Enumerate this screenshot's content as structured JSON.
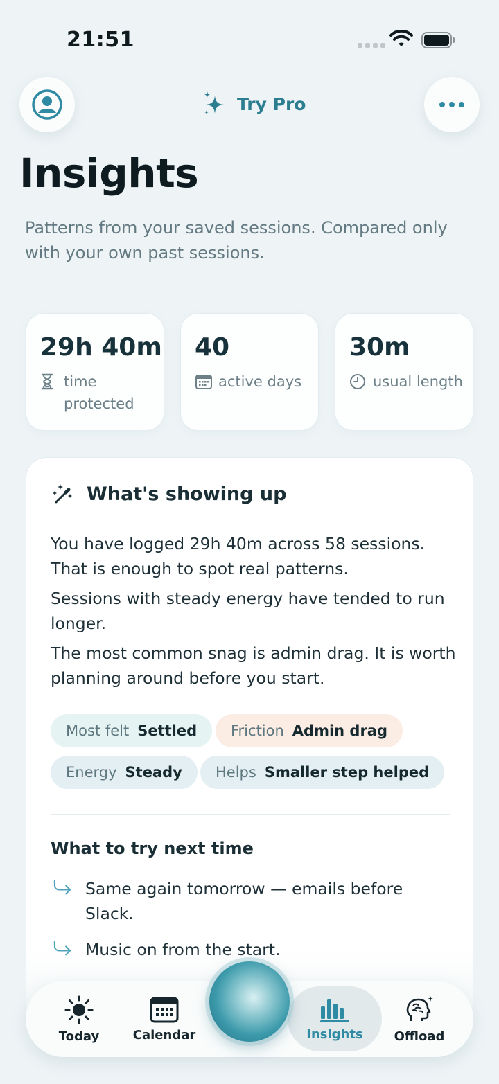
{
  "status": {
    "time": "21:51"
  },
  "header": {
    "try_pro_label": "Try Pro"
  },
  "page": {
    "title": "Insights",
    "subtitle": "Patterns from your saved sessions. Compared only with your own past sessions."
  },
  "stats": [
    {
      "value": "29h 40m",
      "label": "time protected",
      "icon": "hourglass-icon"
    },
    {
      "value": "40",
      "label": "active days",
      "icon": "calendar-icon"
    },
    {
      "value": "30m",
      "label": "usual length",
      "icon": "clock-icon"
    }
  ],
  "insight_card": {
    "title": "What's showing up",
    "lines": [
      "You have logged 29h 40m across 58 sessions. That is enough to spot real patterns.",
      "Sessions with steady energy have tended to run longer.",
      "The most common snag is admin drag. It is worth planning around before you start."
    ],
    "chips": [
      {
        "key": "Most felt",
        "value": "Settled"
      },
      {
        "key": "Friction",
        "value": "Admin drag"
      },
      {
        "key": "Energy",
        "value": "Steady"
      },
      {
        "key": "Helps",
        "value": "Smaller step helped"
      }
    ],
    "next_title": "What to try next time",
    "next_items": [
      "Same again tomorrow — emails before Slack.",
      "Music on from the start."
    ]
  },
  "tabs": [
    {
      "label": "Today",
      "icon": "sun-icon"
    },
    {
      "label": "Calendar",
      "icon": "calendar-icon"
    },
    {
      "label": "Insights",
      "icon": "bar-chart-icon",
      "active": true
    },
    {
      "label": "Offload",
      "icon": "brain-icon"
    }
  ],
  "colors": {
    "accent": "#2f8aa3",
    "background": "#eef4f6"
  }
}
